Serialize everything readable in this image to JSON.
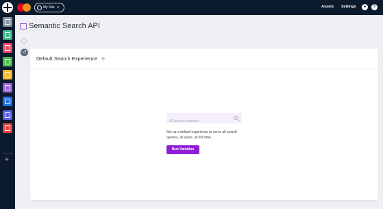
{
  "topbar": {
    "site_selector": "My Site",
    "assets": "Assets",
    "settings": "Settings",
    "help_glyph": "?"
  },
  "sidebar": {
    "apps": [
      {
        "icon": "grid-icon",
        "color": "#8a95a5"
      },
      {
        "icon": "users-icon",
        "color": "#3fb88d"
      },
      {
        "icon": "browser-icon",
        "color": "#e84d6f"
      },
      {
        "icon": "phone-icon",
        "color": "#4cba4a"
      },
      {
        "icon": "mail-icon",
        "color": "#f4b32a"
      },
      {
        "icon": "wand-icon",
        "color": "#9d61d6"
      },
      {
        "icon": "document-icon",
        "color": "#1e6fe0"
      },
      {
        "icon": "eye-icon",
        "color": "#5b5fe3"
      },
      {
        "icon": "shapes-icon",
        "color": "#e2453f"
      }
    ],
    "add_glyph": "+"
  },
  "header": {
    "title": "Semantic Search API"
  },
  "card": {
    "title": "Default Search Experience",
    "search_placeholder": "All search queries",
    "description": "Set up a default experience to serve all search queries, all users, all the time.",
    "button_label": "New Variation"
  },
  "colors": {
    "topbar_bg": "#0c1a2e",
    "accent": "#8e1fd6",
    "search_bg": "#f5eefb"
  }
}
